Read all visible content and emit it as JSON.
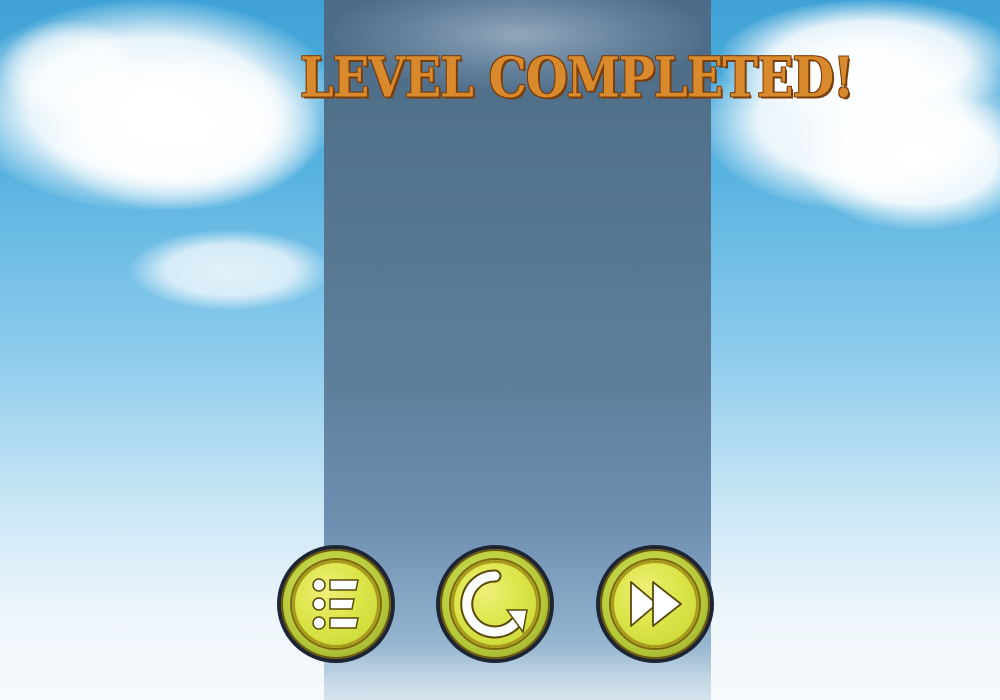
{
  "screen": {
    "title": "LEVEL COMPLETED!"
  },
  "buttons": [
    {
      "id": "menu",
      "icon": "level-menu-icon"
    },
    {
      "id": "replay",
      "icon": "replay-icon"
    },
    {
      "id": "next",
      "icon": "next-level-icon"
    }
  ],
  "colors": {
    "title": "#d98a2c",
    "title_outline": "#7a3e0d",
    "button_face": "#dde64c",
    "button_ring": "#1d2433"
  }
}
